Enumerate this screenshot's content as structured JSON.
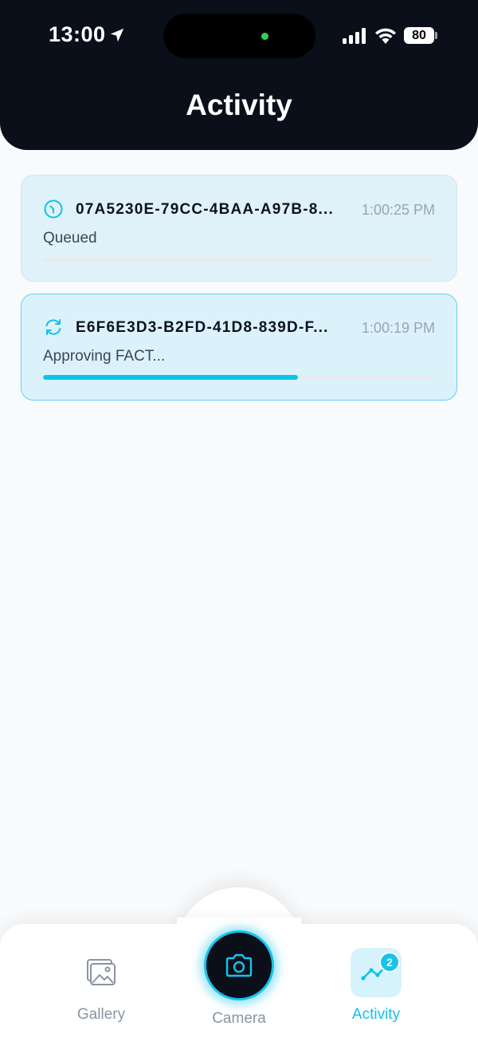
{
  "status_bar": {
    "time": "13:00",
    "battery": "80"
  },
  "header": {
    "title": "Activity"
  },
  "activities": [
    {
      "icon": "clock-icon",
      "id": "07A5230E-79CC-4BAA-A97B-8...",
      "time": "1:00:25 PM",
      "status": "Queued",
      "progress": 0
    },
    {
      "icon": "sync-icon",
      "id": "E6F6E3D3-B2FD-41D8-839D-F...",
      "time": "1:00:19 PM",
      "status": "Approving FACT...",
      "progress": 0.65
    }
  ],
  "tabbar": {
    "gallery_label": "Gallery",
    "camera_label": "Camera",
    "activity_label": "Activity",
    "activity_badge": "2"
  },
  "colors": {
    "accent": "#0fc2ea",
    "header_bg": "#0b0f1a",
    "card_bg": "#e0f2f9",
    "inactive_tab": "#8a94a3"
  }
}
